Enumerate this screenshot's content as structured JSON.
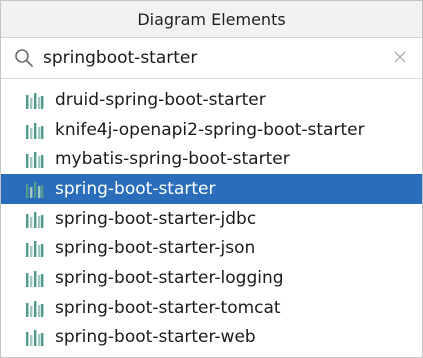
{
  "header": {
    "title": "Diagram Elements"
  },
  "search": {
    "value": "springboot-starter"
  },
  "colors": {
    "selected_bg": "#2a6ebb",
    "icon_bar": "#4f9a8a",
    "icon_bar_light": "#9ec8c0"
  },
  "list": {
    "items": [
      {
        "label": "druid-spring-boot-starter",
        "icon": "library-icon",
        "selected": false
      },
      {
        "label": "knife4j-openapi2-spring-boot-starter",
        "icon": "library-icon",
        "selected": false
      },
      {
        "label": "mybatis-spring-boot-starter",
        "icon": "library-icon",
        "selected": false
      },
      {
        "label": "spring-boot-starter",
        "icon": "library-icon",
        "selected": true
      },
      {
        "label": "spring-boot-starter-jdbc",
        "icon": "library-icon",
        "selected": false
      },
      {
        "label": "spring-boot-starter-json",
        "icon": "library-icon",
        "selected": false
      },
      {
        "label": "spring-boot-starter-logging",
        "icon": "library-icon",
        "selected": false
      },
      {
        "label": "spring-boot-starter-tomcat",
        "icon": "library-icon",
        "selected": false
      },
      {
        "label": "spring-boot-starter-web",
        "icon": "library-icon",
        "selected": false
      }
    ]
  }
}
